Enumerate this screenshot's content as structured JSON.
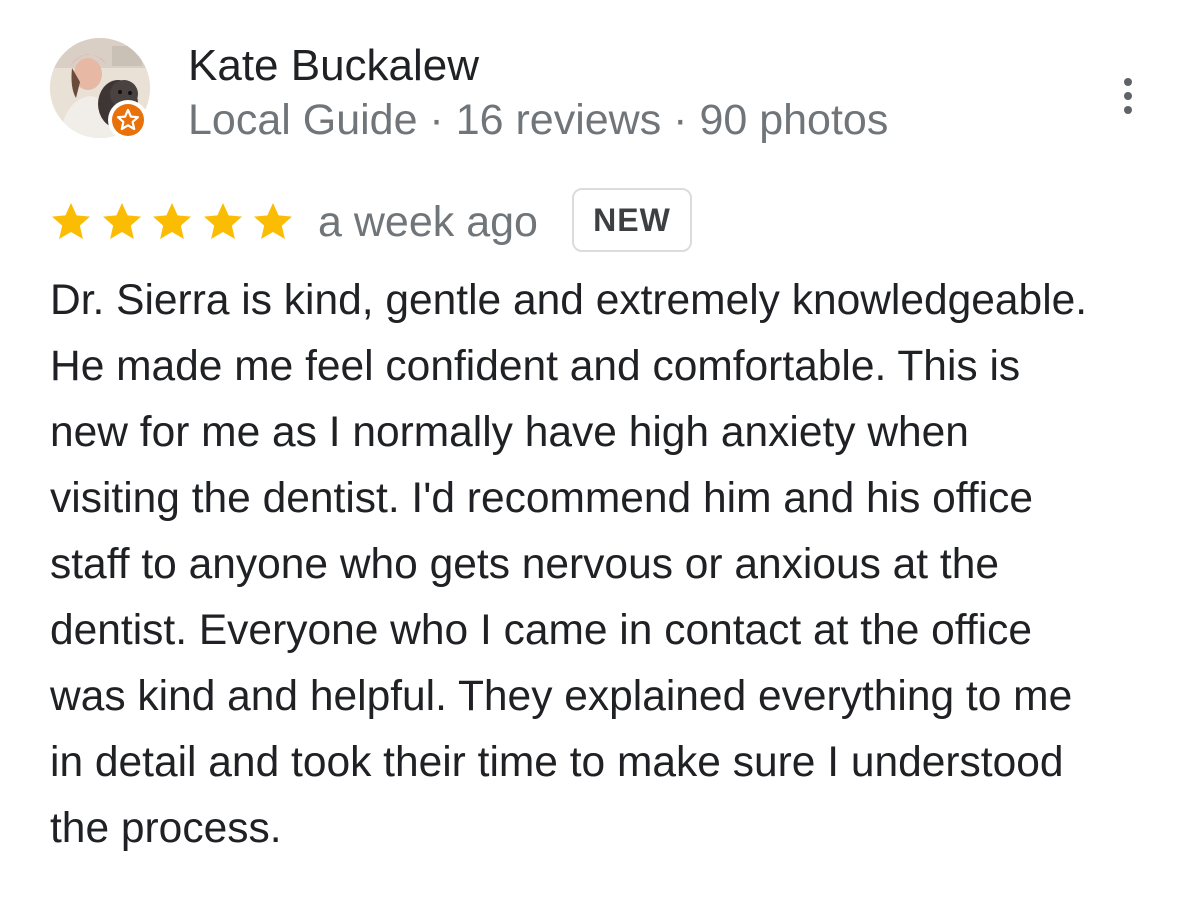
{
  "reviewer": {
    "name": "Kate Buckalew",
    "meta": "Local Guide · 16 reviews · 90 photos",
    "badge_icon": "local-guide-star-icon",
    "avatar_icon": "reviewer-photo"
  },
  "more_menu": {
    "icon": "more-vert-icon"
  },
  "rating": {
    "stars": 5,
    "max_stars": 5,
    "star_color": "#fbbc04",
    "date": "a week ago",
    "badge": "NEW"
  },
  "review": {
    "lines": [
      "Dr. Sierra is kind, gentle and extremely knowledgeable.",
      "He made me feel confident and comfortable. This is",
      "new for me as I normally have high anxiety when",
      "visiting the dentist. I'd recommend him and his office",
      "staff to anyone who gets nervous or anxious at the",
      "dentist. Everyone who I came in contact at the office",
      "was kind and helpful. They explained everything to me",
      "in detail and took their time to make sure I understood",
      "the process."
    ]
  },
  "colors": {
    "primary_text": "#202124",
    "secondary_text": "#70757a",
    "guide_orange": "#e8710a",
    "badge_border": "#dadce0"
  }
}
